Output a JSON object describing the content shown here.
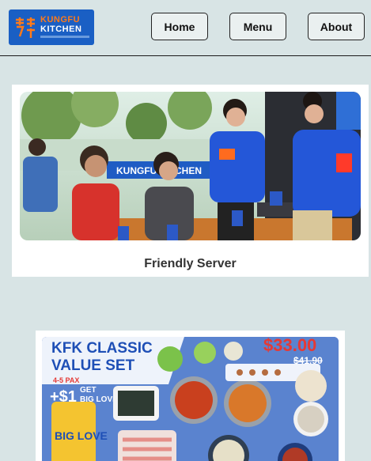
{
  "header": {
    "logo": {
      "cjk": "家傳 麻辣",
      "word_top": "KUNGFU",
      "word_bottom": "KITCHEN"
    },
    "nav": [
      {
        "label": "Home"
      },
      {
        "label": "Menu"
      },
      {
        "label": "About"
      }
    ]
  },
  "feature": {
    "caption": "Friendly Server",
    "photo_sign": "KUNGFU KITCHEN"
  },
  "promo": {
    "title_top": "KFK CLASSIC",
    "title_bottom": "VALUE SET",
    "pax": "4-5 PAX",
    "addon_price": "+$1",
    "addon_get": "GET",
    "addon_text": "BIG LOVE",
    "price": "$33.00",
    "old_price": "$41.90",
    "cup_text": "BIG LOVE"
  },
  "colors": {
    "brand_blue": "#1a5fc4",
    "brand_orange": "#ff7a1a",
    "promo_red": "#e53935",
    "page_bg": "#d8e4e5"
  }
}
